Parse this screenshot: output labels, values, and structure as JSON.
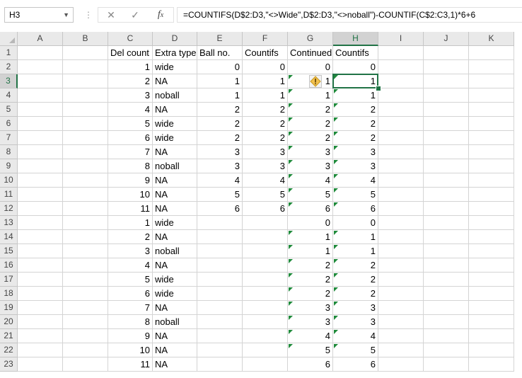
{
  "name_box": {
    "value": "H3",
    "dropdown_icon": "chevron-down-icon"
  },
  "formula_bar": {
    "cancel_icon": "close-icon",
    "enter_icon": "check-icon",
    "function_icon": "fx-icon",
    "formula": "=COUNTIFS(D$2:D3,\"<>Wide\",D$2:D3,\"<>noball\")-COUNTIF(C$2:C3,1)*6+6"
  },
  "columns": [
    "A",
    "B",
    "C",
    "D",
    "E",
    "F",
    "G",
    "H",
    "I",
    "J",
    "K"
  ],
  "selected_cell": "H3",
  "accent_color": "#217346",
  "error_indicator_color": "#1e8a3a",
  "warning_icon": "warning-icon",
  "rows": [
    {
      "n": "1",
      "C": "Del count",
      "D": "Extra type",
      "E": "Ball no.",
      "F": "Countifs",
      "G": "Continued",
      "H": "Countifs"
    },
    {
      "n": "2",
      "C": "1",
      "D": "wide",
      "E": "0",
      "F": "0",
      "G": "0",
      "H": "0"
    },
    {
      "n": "3",
      "C": "2",
      "D": "NA",
      "E": "1",
      "F": "1",
      "G": "1",
      "H": "1"
    },
    {
      "n": "4",
      "C": "3",
      "D": "noball",
      "E": "1",
      "F": "1",
      "G": "1",
      "H": "1"
    },
    {
      "n": "5",
      "C": "4",
      "D": "NA",
      "E": "2",
      "F": "2",
      "G": "2",
      "H": "2"
    },
    {
      "n": "6",
      "C": "5",
      "D": "wide",
      "E": "2",
      "F": "2",
      "G": "2",
      "H": "2"
    },
    {
      "n": "7",
      "C": "6",
      "D": "wide",
      "E": "2",
      "F": "2",
      "G": "2",
      "H": "2"
    },
    {
      "n": "8",
      "C": "7",
      "D": "NA",
      "E": "3",
      "F": "3",
      "G": "3",
      "H": "3"
    },
    {
      "n": "9",
      "C": "8",
      "D": "noball",
      "E": "3",
      "F": "3",
      "G": "3",
      "H": "3"
    },
    {
      "n": "10",
      "C": "9",
      "D": "NA",
      "E": "4",
      "F": "4",
      "G": "4",
      "H": "4"
    },
    {
      "n": "11",
      "C": "10",
      "D": "NA",
      "E": "5",
      "F": "5",
      "G": "5",
      "H": "5"
    },
    {
      "n": "12",
      "C": "11",
      "D": "NA",
      "E": "6",
      "F": "6",
      "G": "6",
      "H": "6"
    },
    {
      "n": "13",
      "C": "1",
      "D": "wide",
      "E": "",
      "F": "",
      "G": "0",
      "H": "0"
    },
    {
      "n": "14",
      "C": "2",
      "D": "NA",
      "E": "",
      "F": "",
      "G": "1",
      "H": "1"
    },
    {
      "n": "15",
      "C": "3",
      "D": "noball",
      "E": "",
      "F": "",
      "G": "1",
      "H": "1"
    },
    {
      "n": "16",
      "C": "4",
      "D": "NA",
      "E": "",
      "F": "",
      "G": "2",
      "H": "2"
    },
    {
      "n": "17",
      "C": "5",
      "D": "wide",
      "E": "",
      "F": "",
      "G": "2",
      "H": "2"
    },
    {
      "n": "18",
      "C": "6",
      "D": "wide",
      "E": "",
      "F": "",
      "G": "2",
      "H": "2"
    },
    {
      "n": "19",
      "C": "7",
      "D": "NA",
      "E": "",
      "F": "",
      "G": "3",
      "H": "3"
    },
    {
      "n": "20",
      "C": "8",
      "D": "noball",
      "E": "",
      "F": "",
      "G": "3",
      "H": "3"
    },
    {
      "n": "21",
      "C": "9",
      "D": "NA",
      "E": "",
      "F": "",
      "G": "4",
      "H": "4"
    },
    {
      "n": "22",
      "C": "10",
      "D": "NA",
      "E": "",
      "F": "",
      "G": "5",
      "H": "5"
    },
    {
      "n": "23",
      "C": "11",
      "D": "NA",
      "E": "",
      "F": "",
      "G": "6",
      "H": "6"
    }
  ]
}
